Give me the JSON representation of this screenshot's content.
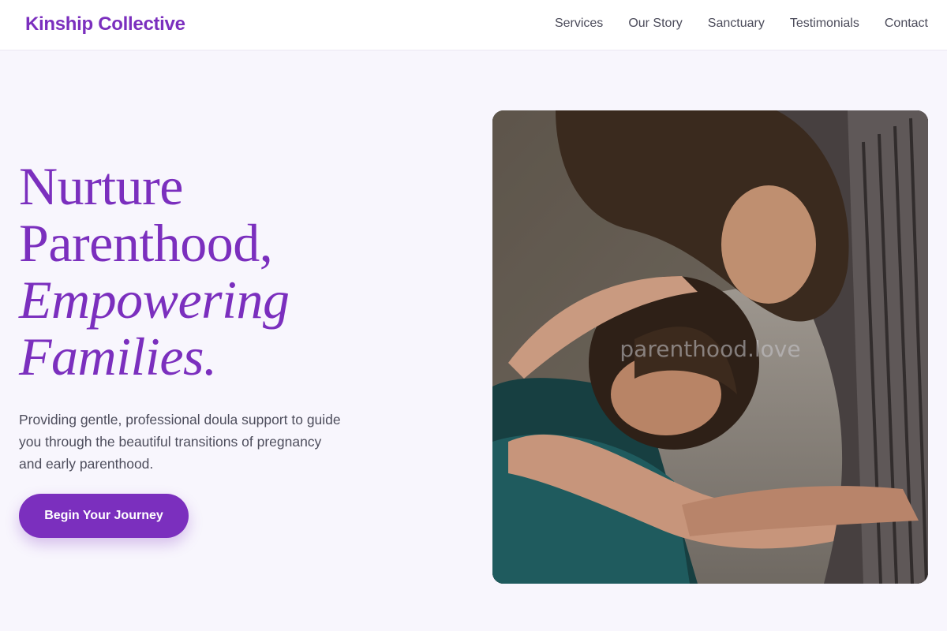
{
  "header": {
    "brand": "Kinship Collective",
    "nav": [
      "Services",
      "Our Story",
      "Sanctuary",
      "Testimonials",
      "Contact"
    ]
  },
  "hero": {
    "headline_line1": "Nurture",
    "headline_line2": "Parenthood,",
    "headline_line3": "Empowering",
    "headline_line4": "Families.",
    "description": "Providing gentle, professional doula support to guide you through the beautiful transitions of pregnancy and early parenthood.",
    "cta_label": "Begin Your Journey",
    "image_watermark": "parenthood.love"
  },
  "colors": {
    "accent": "#7b2fbe",
    "page_background": "#f8f6fd",
    "header_background": "#ffffff",
    "body_text": "#4d4d5c"
  }
}
